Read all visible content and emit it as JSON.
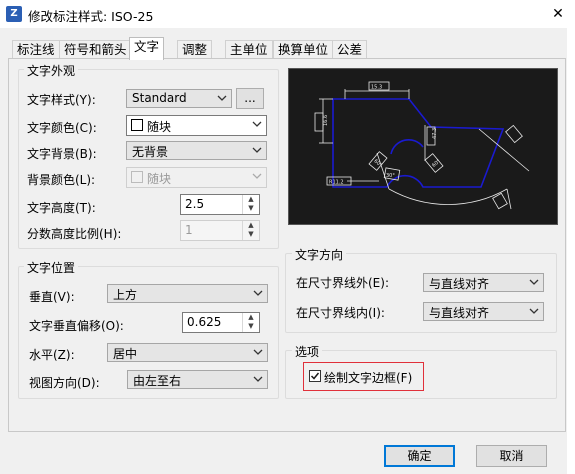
{
  "window": {
    "title": "修改标注样式: ISO-25",
    "close_glyph": "✕"
  },
  "tabs": [
    "标注线",
    "符号和箭头",
    "文字",
    "调整",
    "主单位",
    "换算单位",
    "公差"
  ],
  "active_tab": "文字",
  "text_appearance": {
    "group_title": "文字外观",
    "style_label": "文字样式(Y):",
    "style_value": "Standard",
    "style_browse": "...",
    "color_label": "文字颜色(C):",
    "color_value": "随块",
    "bg_label": "文字背景(B):",
    "bg_value": "无背景",
    "bgcolor_label": "背景颜色(L):",
    "bgcolor_value": "随块",
    "height_label": "文字高度(T):",
    "height_value": "2.5",
    "fraction_label": "分数高度比例(H):",
    "fraction_value": "1"
  },
  "text_placement": {
    "group_title": "文字位置",
    "vertical_label": "垂直(V):",
    "vertical_value": "上方",
    "offset_label": "文字垂直偏移(O):",
    "offset_value": "0.625",
    "horizontal_label": "水平(Z):",
    "horizontal_value": "居中",
    "view_label": "视图方向(D):",
    "view_value": "由左至右"
  },
  "text_direction": {
    "group_title": "文字方向",
    "outside_label": "在尺寸界线外(E):",
    "outside_value": "与直线对齐",
    "inside_label": "在尺寸界线内(I):",
    "inside_value": "与直线对齐"
  },
  "options": {
    "group_title": "选项",
    "frame_label": "绘制文字边框(F)",
    "frame_checked": true
  },
  "preview": {
    "labels": [
      "15.3",
      "16.6",
      "R11.2",
      "47.3",
      "30°",
      "60°",
      "60°"
    ]
  },
  "buttons": {
    "ok": "确定",
    "cancel": "取消"
  },
  "colors": {
    "preview_bg": "#1a1a1a",
    "geometry": "#1a1ad0",
    "dims": "#ffffff",
    "highlight": "#e0303a"
  }
}
